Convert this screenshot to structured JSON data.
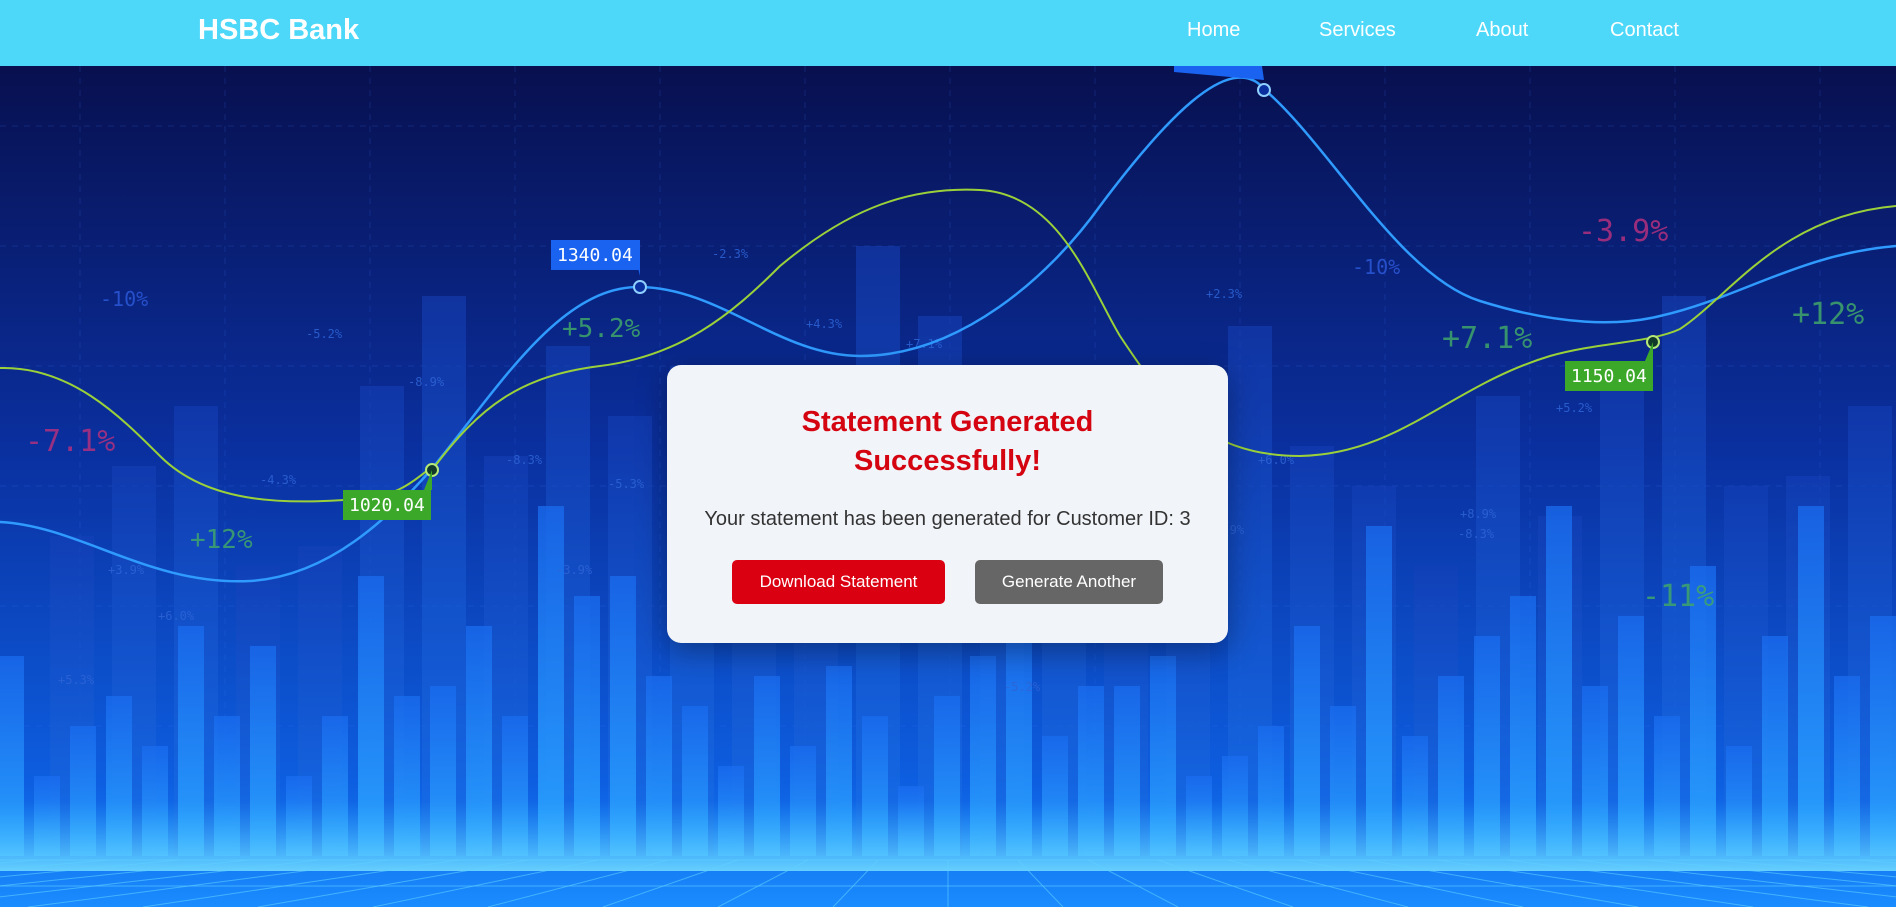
{
  "header": {
    "brand": "HSBC Bank",
    "nav": [
      "Home",
      "Services",
      "About",
      "Contact"
    ]
  },
  "background": {
    "price_tags": [
      "1340.04",
      "1020.04",
      "1150.04"
    ],
    "percent_labels": [
      "-10%",
      "-7.1%",
      "+12%",
      "+5.2%",
      "-2.3%",
      "+4.3%",
      "+7.1%",
      "-5.2%",
      "-8.9%",
      "-4.3%",
      "-8.3%",
      "-5.3%",
      "-3.9%",
      "+6.0%",
      "+3.9%",
      "+5.3%",
      "+2.3%",
      "-10%",
      "+7.1%",
      "-3.9%",
      "+12%",
      "+5.2%",
      "+8.9%",
      "-11%",
      "+6.0%",
      "-8.3%",
      "+1.9%",
      "-5.2%"
    ]
  },
  "modal": {
    "title": "Statement Generated Successfully!",
    "message": "Your statement has been generated for Customer ID: 3",
    "download_label": "Download Statement",
    "generate_label": "Generate Another"
  },
  "colors": {
    "navbar": "#4dd8fa",
    "title_red": "#d40511",
    "download_button": "#db0011",
    "generate_button": "#666666"
  }
}
